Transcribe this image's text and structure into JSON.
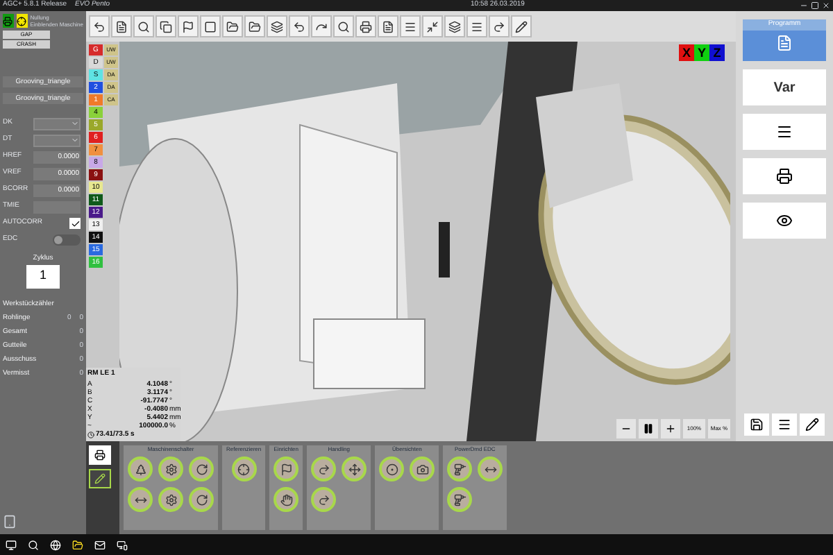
{
  "title_bar": {
    "app": "AGC+ 5.8.1 Release",
    "machine": "EVO Pento",
    "datetime": "10:58  26.03.2019"
  },
  "left_panel": {
    "mode_lines": [
      "Nullung",
      "Einblenden Maschine"
    ],
    "buttons": [
      "GAP",
      "CRASH"
    ],
    "tool_fields": [
      "Grooving_triangle",
      "Grooving_triangle"
    ],
    "params": [
      {
        "label": "DK",
        "kind": "dropdown"
      },
      {
        "label": "DT",
        "kind": "dropdown"
      },
      {
        "label": "HREF",
        "kind": "number",
        "value": "0.0000"
      },
      {
        "label": "VREF",
        "kind": "number",
        "value": "0.0000"
      },
      {
        "label": "BCORR",
        "kind": "number",
        "value": "0.0000"
      },
      {
        "label": "TMIE",
        "kind": "blank"
      },
      {
        "label": "AUTOCORR",
        "kind": "checkbox",
        "checked": true
      },
      {
        "label": "EDC",
        "kind": "toggle",
        "on": false
      }
    ],
    "cycle": {
      "label": "Zyklus",
      "value": "1"
    },
    "counter": {
      "title": "Werkstückzähler",
      "rows": [
        {
          "label": "Rohlinge",
          "values": [
            "0",
            "0"
          ]
        },
        {
          "label": "Gesamt",
          "values": [
            "0"
          ]
        },
        {
          "label": "Gutteile",
          "values": [
            "0"
          ]
        },
        {
          "label": "Ausschuss",
          "values": [
            "0"
          ]
        },
        {
          "label": "Vermisst",
          "values": [
            "0"
          ]
        }
      ]
    }
  },
  "channels": [
    {
      "label": "G",
      "color": "#d62b2b",
      "tag": "UW"
    },
    {
      "label": "D",
      "color": "#d9d9d9",
      "tag": "UW"
    },
    {
      "label": "S",
      "color": "#5fe3e3",
      "tag": "DA"
    },
    {
      "label": "2",
      "color": "#2050e0",
      "tag": "DA"
    },
    {
      "label": "1",
      "color": "#f07a2a",
      "tag": "CA"
    },
    {
      "label": "4",
      "color": "#8ad13a"
    },
    {
      "label": "5",
      "color": "#9aa82a"
    },
    {
      "label": "6",
      "color": "#e02020"
    },
    {
      "label": "7",
      "color": "#f09040"
    },
    {
      "label": "8",
      "color": "#c8a8e8"
    },
    {
      "label": "9",
      "color": "#8a1010"
    },
    {
      "label": "10",
      "color": "#e8e890"
    },
    {
      "label": "11",
      "color": "#0f5a1a"
    },
    {
      "label": "12",
      "color": "#4a1a8a"
    },
    {
      "label": "13",
      "color": "#f0f0f0"
    },
    {
      "label": "14",
      "color": "#101010"
    },
    {
      "label": "15",
      "color": "#2a6ae0"
    },
    {
      "label": "16",
      "color": "#30c040"
    }
  ],
  "axes": [
    {
      "label": "X",
      "color": "#e01010"
    },
    {
      "label": "Y",
      "color": "#10d010"
    },
    {
      "label": "Z",
      "color": "#1010d0"
    }
  ],
  "readout": {
    "title": "RM LE 1",
    "rows": [
      {
        "axis": "A",
        "value": "4.1048",
        "unit": "°"
      },
      {
        "axis": "B",
        "value": "3.1174",
        "unit": "°"
      },
      {
        "axis": "C",
        "value": "-91.7747",
        "unit": "°"
      },
      {
        "axis": "X",
        "value": "-0.4080",
        "unit": "mm"
      },
      {
        "axis": "Y",
        "value": "5.4402",
        "unit": "mm"
      },
      {
        "axis": "~",
        "value": "100000.0",
        "unit": "%"
      }
    ],
    "footer": "73.41/73.5 s"
  },
  "playback": {
    "feed": "100%",
    "max": "Max %"
  },
  "right_panel": {
    "tab": "Programm",
    "var": "Var"
  },
  "function_groups": [
    {
      "title": "Maschinenschalter",
      "buttons": [
        {
          "kind": "tree"
        },
        {
          "kind": "cog"
        },
        {
          "kind": "curve"
        },
        {
          "kind": "arrows"
        },
        {
          "kind": "cog"
        },
        {
          "kind": "curve"
        }
      ]
    },
    {
      "title": "Referenzieren",
      "buttons": [
        {
          "kind": "target"
        }
      ]
    },
    {
      "title": "Einrichten",
      "buttons": [
        {
          "kind": "flag"
        },
        {
          "kind": "hand"
        }
      ]
    },
    {
      "title": "Handling",
      "buttons": [
        {
          "kind": "redo"
        },
        {
          "kind": "move"
        },
        {
          "kind": "redo"
        }
      ]
    },
    {
      "title": "Übersichten",
      "buttons": [
        {
          "kind": "circle"
        },
        {
          "kind": "camera"
        }
      ]
    },
    {
      "title": "PowerDmd EDC",
      "buttons": [
        {
          "kind": "drill"
        },
        {
          "kind": "arrows"
        },
        {
          "kind": "drill"
        }
      ]
    }
  ]
}
